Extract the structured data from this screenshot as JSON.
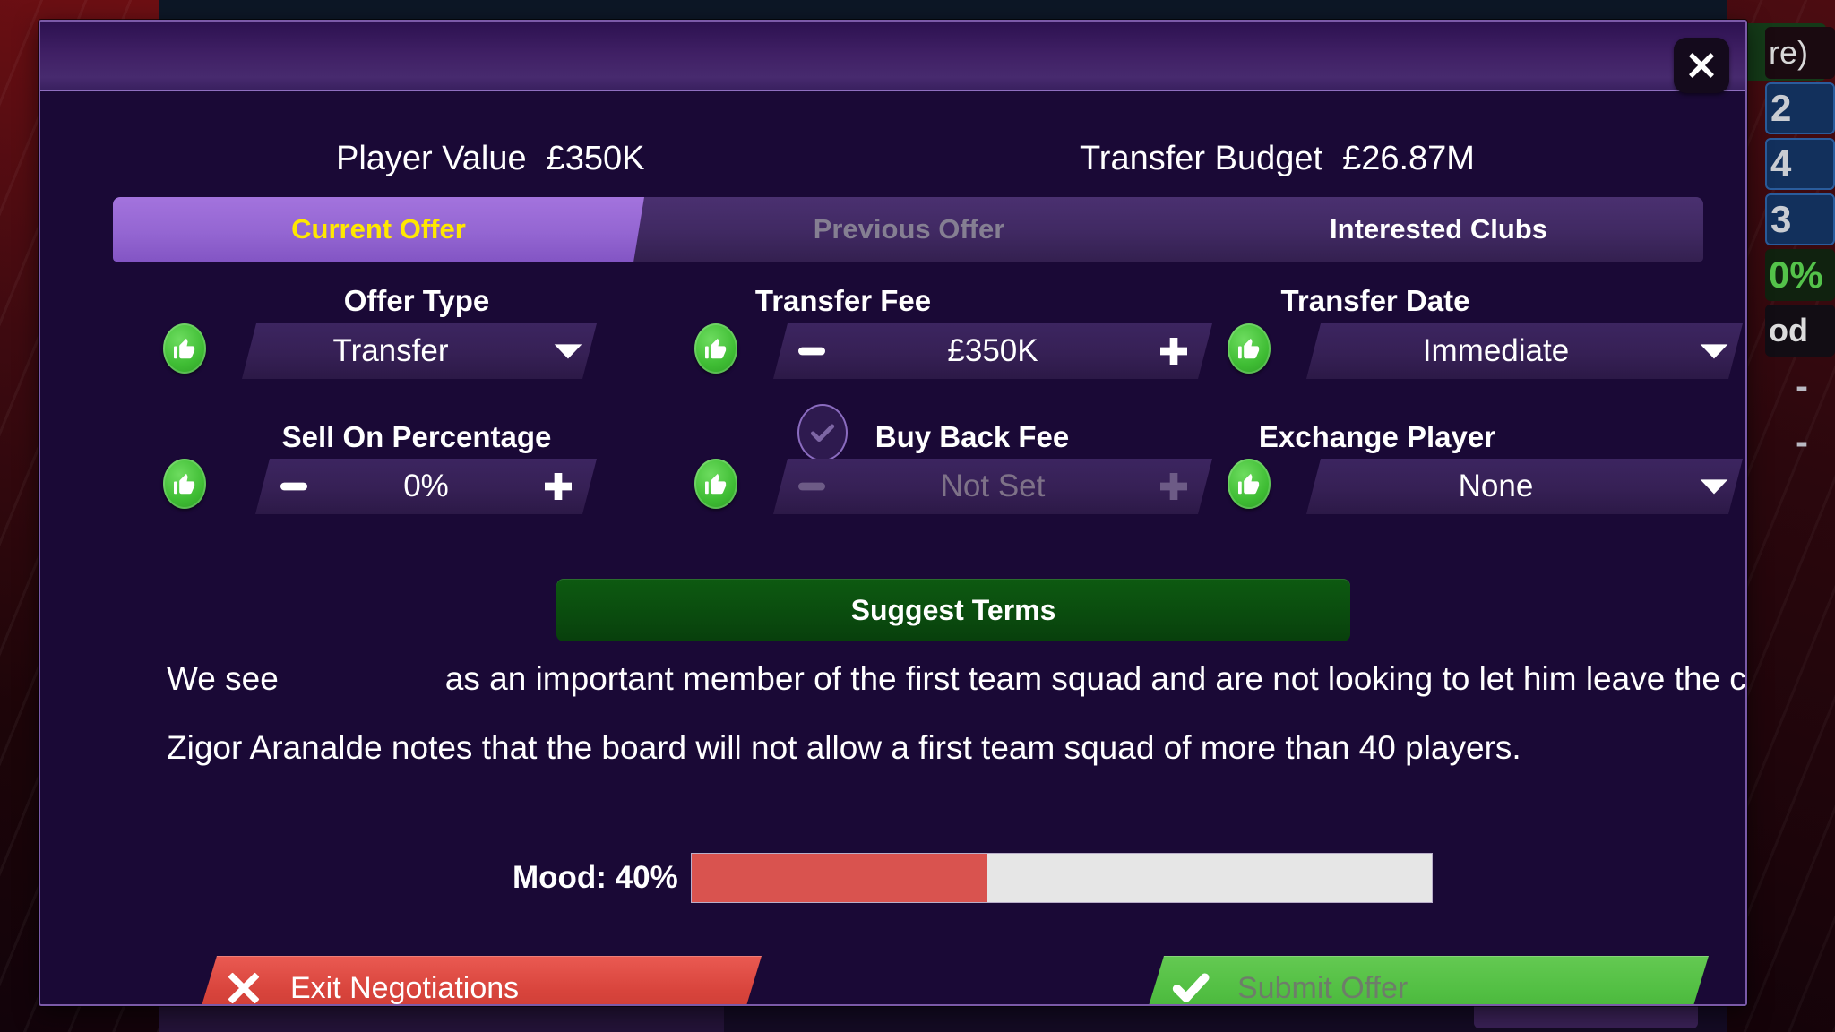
{
  "background": {
    "right_column_chips": [
      {
        "text": "re)",
        "style": "dark"
      },
      {
        "text": "2",
        "style": "blue"
      },
      {
        "text": "4",
        "style": "blue"
      },
      {
        "text": "3",
        "style": "blue"
      },
      {
        "text": "0%",
        "style": "green"
      },
      {
        "text": "od",
        "style": "greenlbl"
      },
      {
        "text": "-",
        "style": "plain"
      },
      {
        "text": "-",
        "style": "plain"
      }
    ]
  },
  "modal": {
    "close_icon": "close-icon",
    "summary": {
      "player_value_label": "Player Value",
      "player_value": "£350K",
      "transfer_budget_label": "Transfer Budget",
      "transfer_budget": "£26.87M"
    },
    "tabs": [
      {
        "label": "Current Offer",
        "state": "active"
      },
      {
        "label": "Previous Offer",
        "state": "disabled"
      },
      {
        "label": "Interested Clubs",
        "state": "normal"
      }
    ],
    "fields": {
      "offer_type": {
        "label": "Offer Type",
        "value": "Transfer",
        "control": "dropdown",
        "thumb_icon": "thumbs-up-icon",
        "caret_icon": "chevron-down-icon"
      },
      "transfer_fee": {
        "label": "Transfer Fee",
        "value": "£350K",
        "control": "stepper",
        "thumb_icon": "thumbs-up-icon",
        "minus_icon": "minus-icon",
        "plus_icon": "plus-icon"
      },
      "transfer_date": {
        "label": "Transfer Date",
        "value": "Immediate",
        "control": "dropdown",
        "thumb_icon": "thumbs-up-icon",
        "caret_icon": "chevron-down-icon"
      },
      "sell_on_percentage": {
        "label": "Sell On Percentage",
        "value": "0%",
        "control": "stepper",
        "thumb_icon": "thumbs-up-icon",
        "minus_icon": "minus-icon",
        "plus_icon": "plus-icon"
      },
      "buy_back_fee": {
        "label": "Buy Back Fee",
        "value": "Not Set",
        "control": "stepper",
        "enabled": false,
        "checkbox_icon": "check-icon",
        "minus_icon": "minus-icon",
        "plus_icon": "plus-icon"
      },
      "exchange_player": {
        "label": "Exchange Player",
        "value": "None",
        "control": "dropdown",
        "thumb_icon": "thumbs-up-icon",
        "caret_icon": "chevron-down-icon"
      }
    },
    "suggest_terms_label": "Suggest Terms",
    "messages": {
      "line1_before": "We see",
      "line1_after": "as an important member of the first team squad and are not looking to let him leave the club.",
      "line2": "Zigor Aranalde notes that the board will not allow a first team squad of more than 40 players."
    },
    "mood": {
      "label": "Mood: 40%",
      "percent": 40,
      "fill_color": "#d9534f",
      "track_color": "#e6e6e6"
    },
    "footer": {
      "exit_label": "Exit Negotiations",
      "exit_icon": "cross-icon",
      "exit_color": "#d8443c",
      "submit_label": "Submit Offer",
      "submit_icon": "check-icon",
      "submit_color": "#52bf43",
      "submit_enabled": false
    }
  }
}
